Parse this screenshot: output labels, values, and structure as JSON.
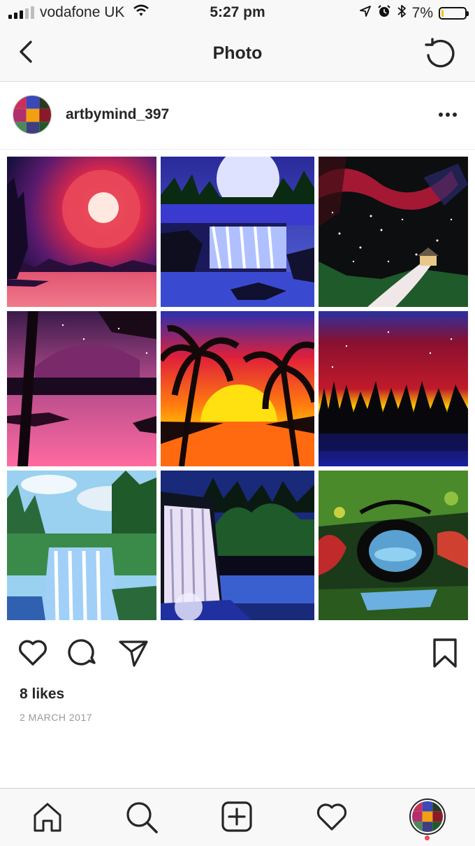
{
  "status_bar": {
    "carrier": "vodafone UK",
    "time": "5:27 pm",
    "battery_percent": "7%"
  },
  "nav": {
    "title": "Photo"
  },
  "post": {
    "username": "artbymind_397",
    "likes": "8 likes",
    "date": "2 MARCH 2017"
  },
  "colors": {
    "background": "#ffffff",
    "bar_background": "#f8f8f8",
    "text": "#262626",
    "muted_text": "#999999",
    "notification_dot": "#ed4956",
    "battery_low": "#f5c400"
  },
  "icons": {
    "back": "chevron-left-icon",
    "refresh": "refresh-icon",
    "more": "more-horizontal-icon",
    "like": "heart-icon",
    "comment": "comment-icon",
    "share": "send-icon",
    "save": "bookmark-icon",
    "home": "home-icon",
    "search": "search-icon",
    "new_post": "add-post-icon",
    "activity": "heart-icon",
    "profile": "profile-avatar"
  },
  "photo_grid": {
    "paintings": [
      "red moon over pink lake",
      "waterfall under full moon",
      "aurora over snowy cabin",
      "pink night lake with trees",
      "palm trees at sunset",
      "red sky over forest",
      "waterfall in green forest",
      "white waterfall at night",
      "green bridge reflection"
    ]
  }
}
